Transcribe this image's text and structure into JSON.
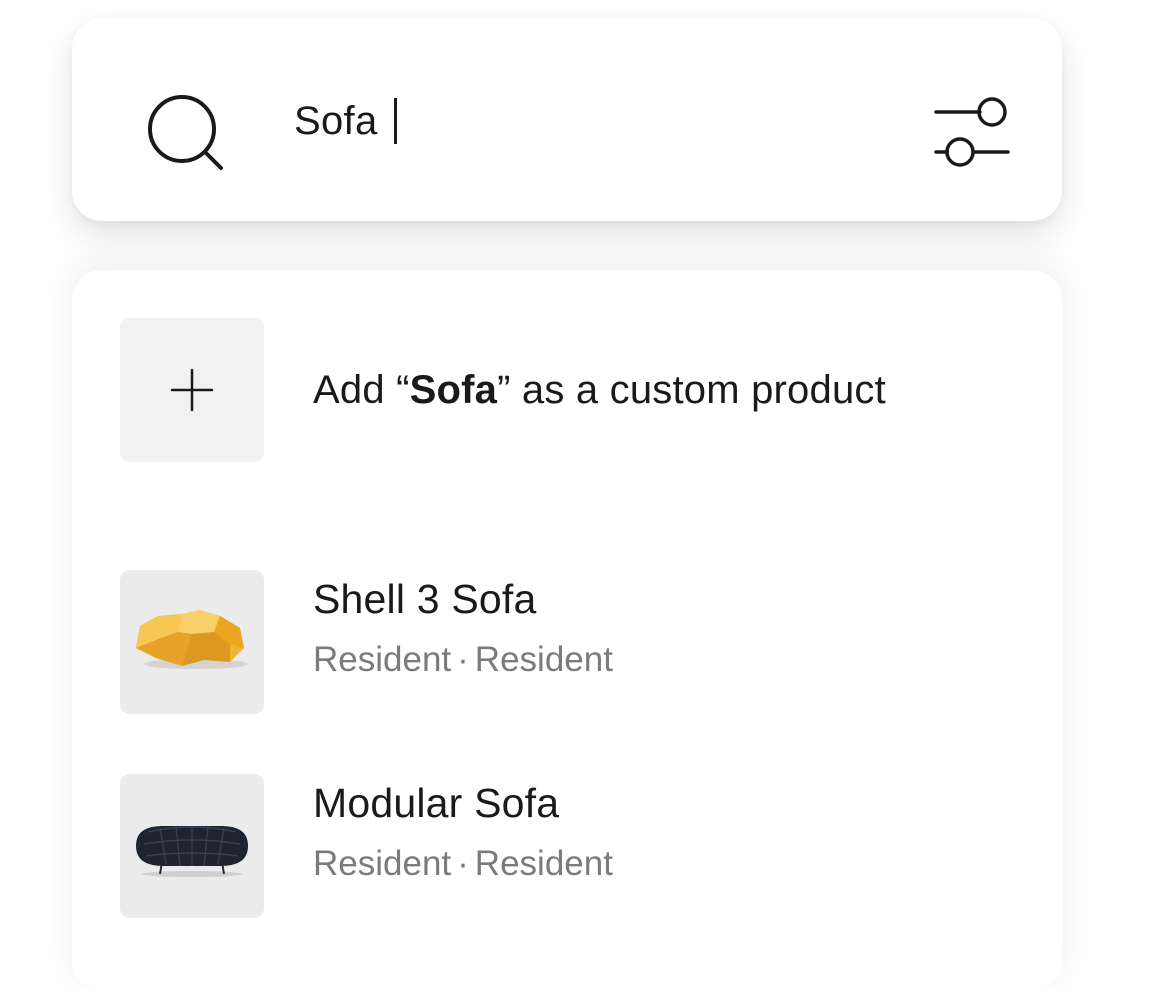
{
  "search": {
    "value": "Sofa",
    "icon": "search-icon",
    "filter_icon": "sliders-icon"
  },
  "custom_product": {
    "prefix": "Add “",
    "query": "Sofa",
    "suffix": "” as a custom product",
    "icon": "plus-icon"
  },
  "results": [
    {
      "name": "Shell 3 Sofa",
      "brand": "Resident",
      "collection": "Resident",
      "separator": "·",
      "image_color": "#F2B233"
    },
    {
      "name": "Modular Sofa",
      "brand": "Resident",
      "collection": "Resident",
      "separator": "·",
      "image_color": "#1E2430"
    }
  ],
  "colors": {
    "text_primary": "#1a1a1a",
    "text_secondary": "#7b7b7b",
    "tile_background": "#ebebeb"
  }
}
